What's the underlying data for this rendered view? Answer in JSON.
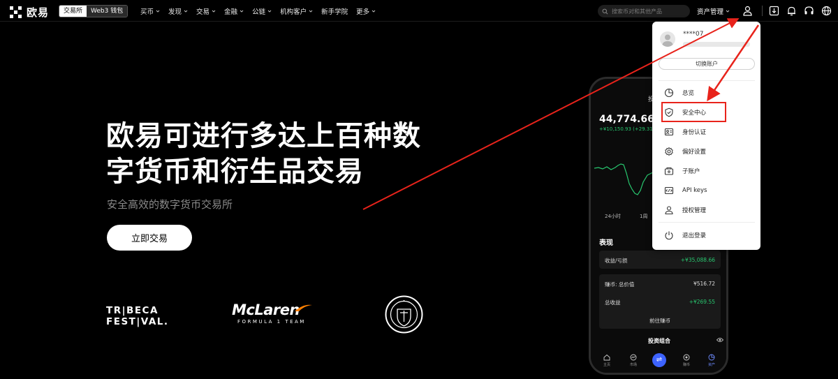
{
  "nav": {
    "logo_text": "欧易",
    "segments": [
      "交易所",
      "Web3 钱包"
    ],
    "menu": [
      {
        "label": "买币",
        "has_caret": true
      },
      {
        "label": "发现",
        "has_caret": true
      },
      {
        "label": "交易",
        "has_caret": true
      },
      {
        "label": "金融",
        "has_caret": true
      },
      {
        "label": "公链",
        "has_caret": true
      },
      {
        "label": "机构客户",
        "has_caret": true
      },
      {
        "label": "新手学院",
        "has_caret": false
      },
      {
        "label": "更多",
        "has_caret": true
      }
    ],
    "search_placeholder": "搜索币对和其他产品",
    "asset_menu": "资产管理",
    "icons": [
      "user-icon",
      "download-icon",
      "bell-icon",
      "headset-icon",
      "globe-icon"
    ]
  },
  "hero": {
    "title_line1": "欧易可进行多达上百种数",
    "title_line2": "字货币和衍生品交易",
    "subtitle": "安全高效的数字货币交易所",
    "cta": "立即交易"
  },
  "partners": {
    "tribeca_line1": "TR|BECA",
    "tribeca_line2": "FEST|VAL.",
    "mclaren_name": "McLaren",
    "mclaren_sub": "FORMULA 1 TEAM"
  },
  "phone": {
    "title": "投",
    "balance": "44,774.66 CN",
    "change": "+¥10,150.93 (+29.31%)",
    "ranges": [
      "24小时",
      "1周"
    ],
    "performance_title": "表现",
    "pnl_label": "收益/亏损",
    "pnl_value": "+¥35,088.66",
    "earn_total_label": "赚币: 总价值",
    "earn_total_value": "¥516.72",
    "total_income_label": "总收益",
    "total_income_value": "+¥269.55",
    "earn_button": "前往赚币",
    "portfolio_title": "投资组合",
    "tabs": [
      "主页",
      "市场",
      "",
      "赚币",
      "资产"
    ]
  },
  "dropdown": {
    "username": "****07",
    "switch_account": "切换账户",
    "items": [
      {
        "label": "总览",
        "icon": "pie-chart-icon"
      },
      {
        "label": "安全中心",
        "icon": "shield-icon"
      },
      {
        "label": "身份认证",
        "icon": "id-card-icon"
      },
      {
        "label": "偏好设置",
        "icon": "gear-icon"
      },
      {
        "label": "子账户",
        "icon": "sub-account-icon"
      },
      {
        "label": "API keys",
        "icon": "api-icon"
      },
      {
        "label": "授权管理",
        "icon": "authorize-icon"
      },
      {
        "label": "退出登录",
        "icon": "power-icon"
      }
    ]
  },
  "colors": {
    "background": "#000000",
    "accent_green": "#28c76f",
    "annotation_red": "#e8231b",
    "swap_blue": "#3d63ff"
  }
}
